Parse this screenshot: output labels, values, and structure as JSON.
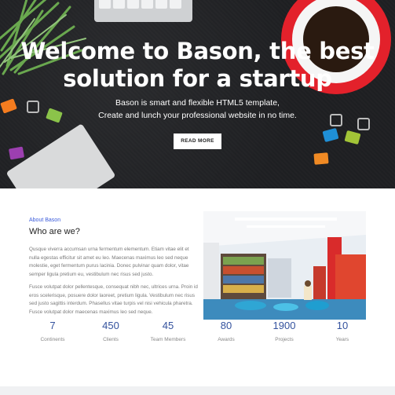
{
  "hero": {
    "headline_line1": "Welcome to Bason, the best",
    "headline_line2": "solution for a startup",
    "sub_line1": "Bason is smart and flexible HTML5 template,",
    "sub_line2": "Create and lunch your professional website in no time.",
    "button_label": "READ MORE"
  },
  "about": {
    "kicker": "About Bason",
    "title": "Who are we?",
    "paragraph1": "Qusque viverra accumsan urna fermentum elementum. Etiam vitae elit et nulla egestas efficitur sit amet eu leo. Maecenas maximus leo sed neque molestie, eget fermentum purus lacinia. Donec pulvinar quam dolor, vitae semper ligula pretium eu, vestibulum nec risus sed justo.",
    "paragraph2": "Fusce volutpat dolor pellentesque, consequat nibh nec, ultrices urna. Proin id eros scelerisque, posuere dolor laoreet, pretium ligula. Vestibulum nec risus sed justo sagittis interdum. Phasellus vitae turpis vel nisi vehicula pharetra. Fusce volutpat dolor maecenas maximus leo sed neque."
  },
  "stats": [
    {
      "value": "7",
      "label": "Continents"
    },
    {
      "value": "450",
      "label": "Clients"
    },
    {
      "value": "45",
      "label": "Team Members"
    },
    {
      "value": "80",
      "label": "Awards"
    },
    {
      "value": "1900",
      "label": "Projects"
    },
    {
      "value": "10",
      "label": "Years"
    }
  ],
  "colors": {
    "accent_blue": "#34529e",
    "kicker_blue": "#3b5bdb",
    "cup_red": "#e3212b",
    "hero_bg": "#1e1f22"
  }
}
